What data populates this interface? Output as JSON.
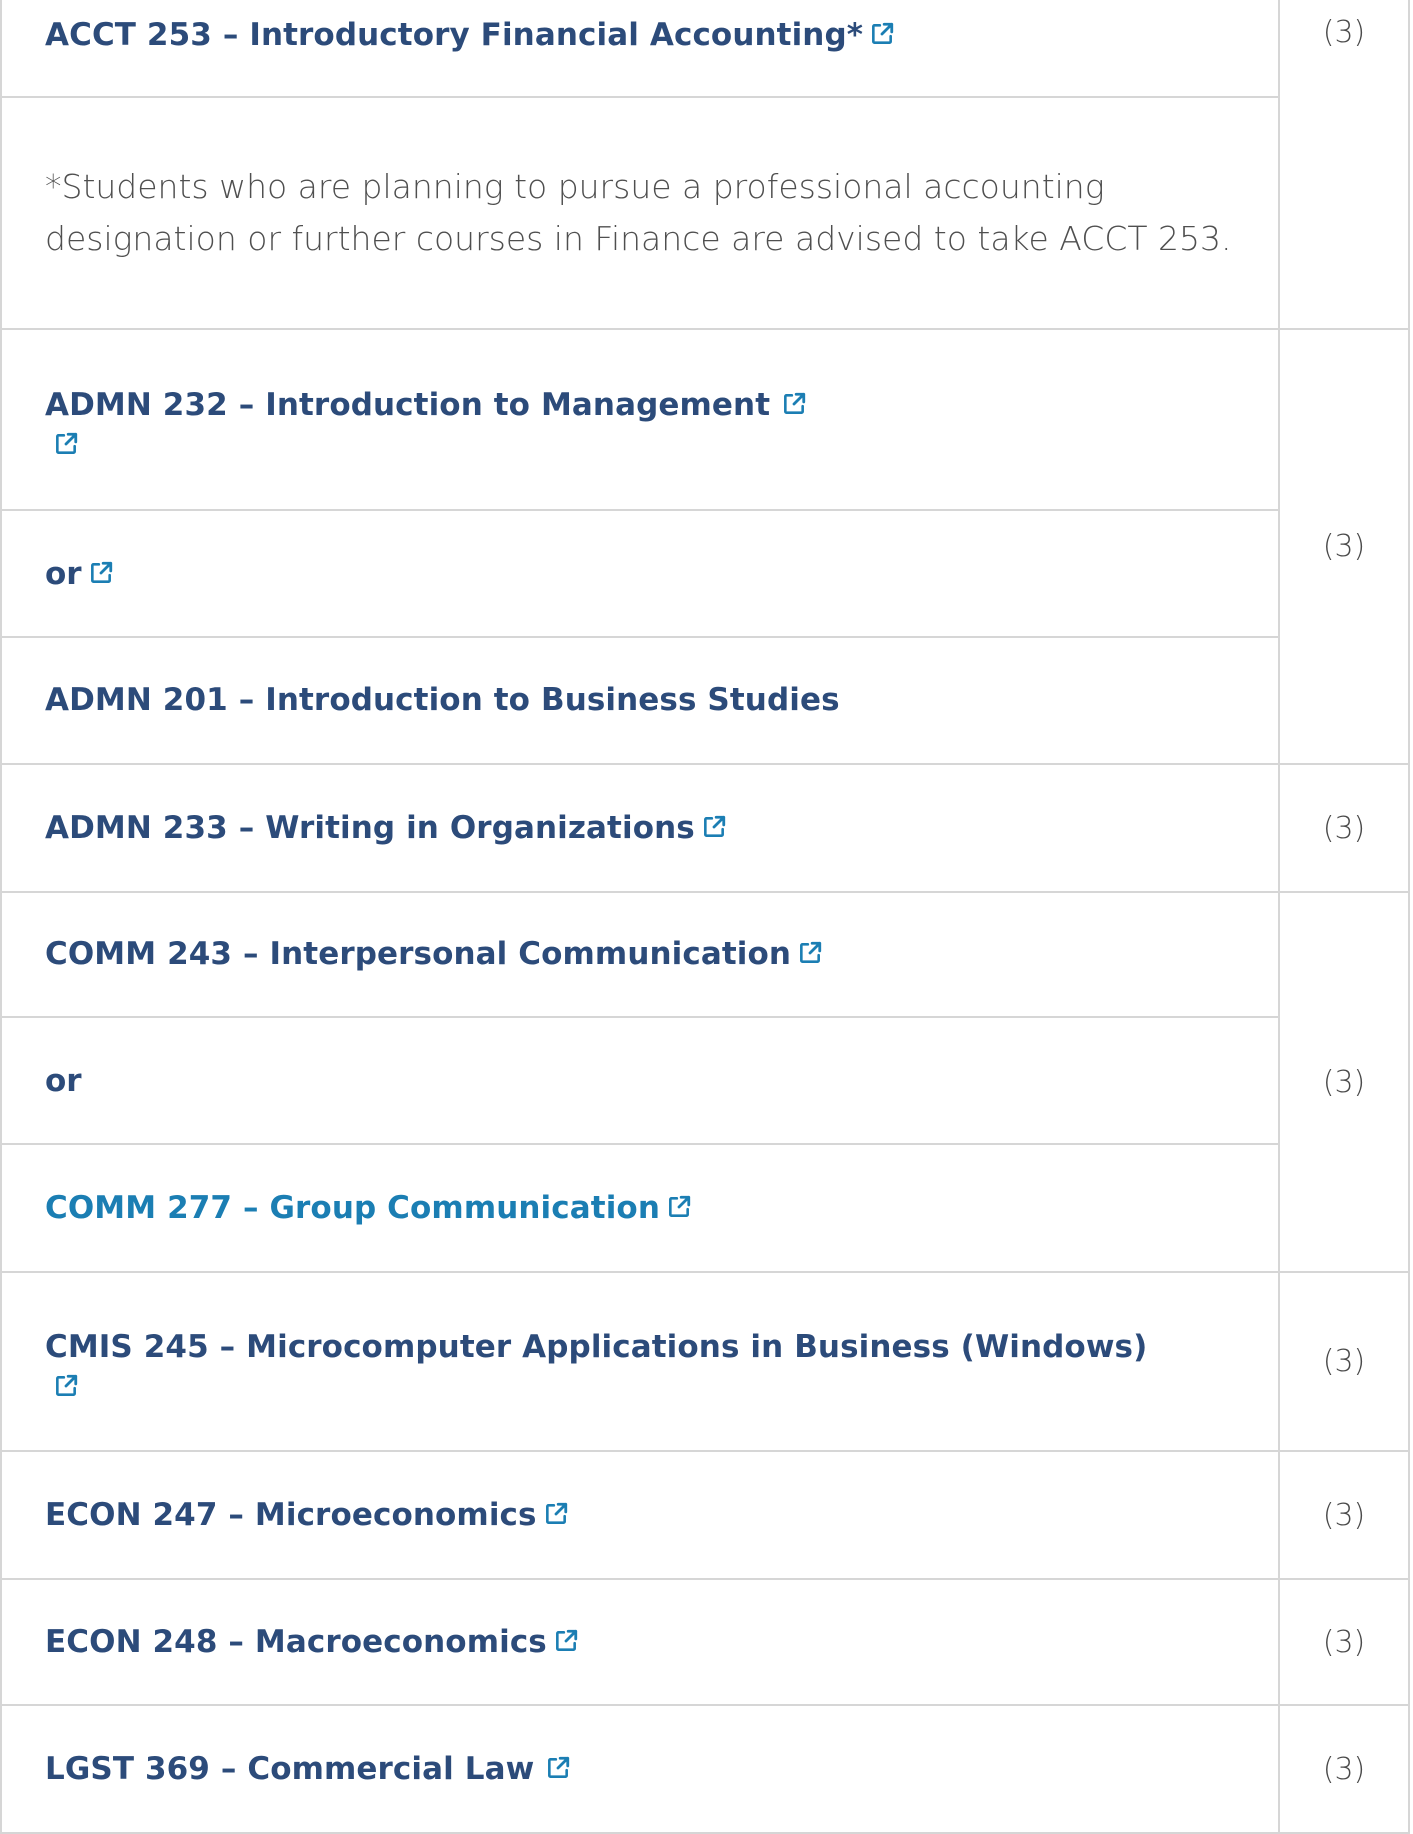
{
  "credit": "(3)",
  "icons": {
    "external_link": "external-link-icon"
  },
  "colors": {
    "link": "#2c4b7a",
    "link_alt": "#1b7eb3",
    "credit": "#4a4a4a",
    "border": "#d6d6d6"
  },
  "rows": {
    "acct253": {
      "label": "ACCT 253 – Introductory Financial Accounting*",
      "credit": "(3)"
    },
    "note": {
      "text": " *Students who are planning to pursue a professional accounting designation or further courses in Finance are advised to take ACCT 253."
    },
    "admn232": {
      "label": "ADMN 232 – Introduction to Management"
    },
    "or1": {
      "label": "or"
    },
    "admn201": {
      "label": "ADMN 201 – Introduction to Business Studies"
    },
    "group1_credit": "(3)",
    "admn233": {
      "label": "ADMN 233 – Writing in Organizations",
      "credit": "(3)"
    },
    "comm243": {
      "label": "COMM 243 – Interpersonal Communication"
    },
    "or2": {
      "label": "or"
    },
    "comm277": {
      "label": "COMM 277 – Group Communication"
    },
    "group2_credit": "(3)",
    "cmis245": {
      "label": "CMIS 245 – Microcomputer Applications in Business (Windows)",
      "credit": "(3)"
    },
    "econ247": {
      "label": "ECON 247 – Microeconomics",
      "credit": "(3)"
    },
    "econ248": {
      "label": "ECON 248 – Macroeconomics",
      "credit": "(3)"
    },
    "lgst369": {
      "label": "LGST 369 – Commercial Law",
      "credit": "(3)"
    }
  }
}
